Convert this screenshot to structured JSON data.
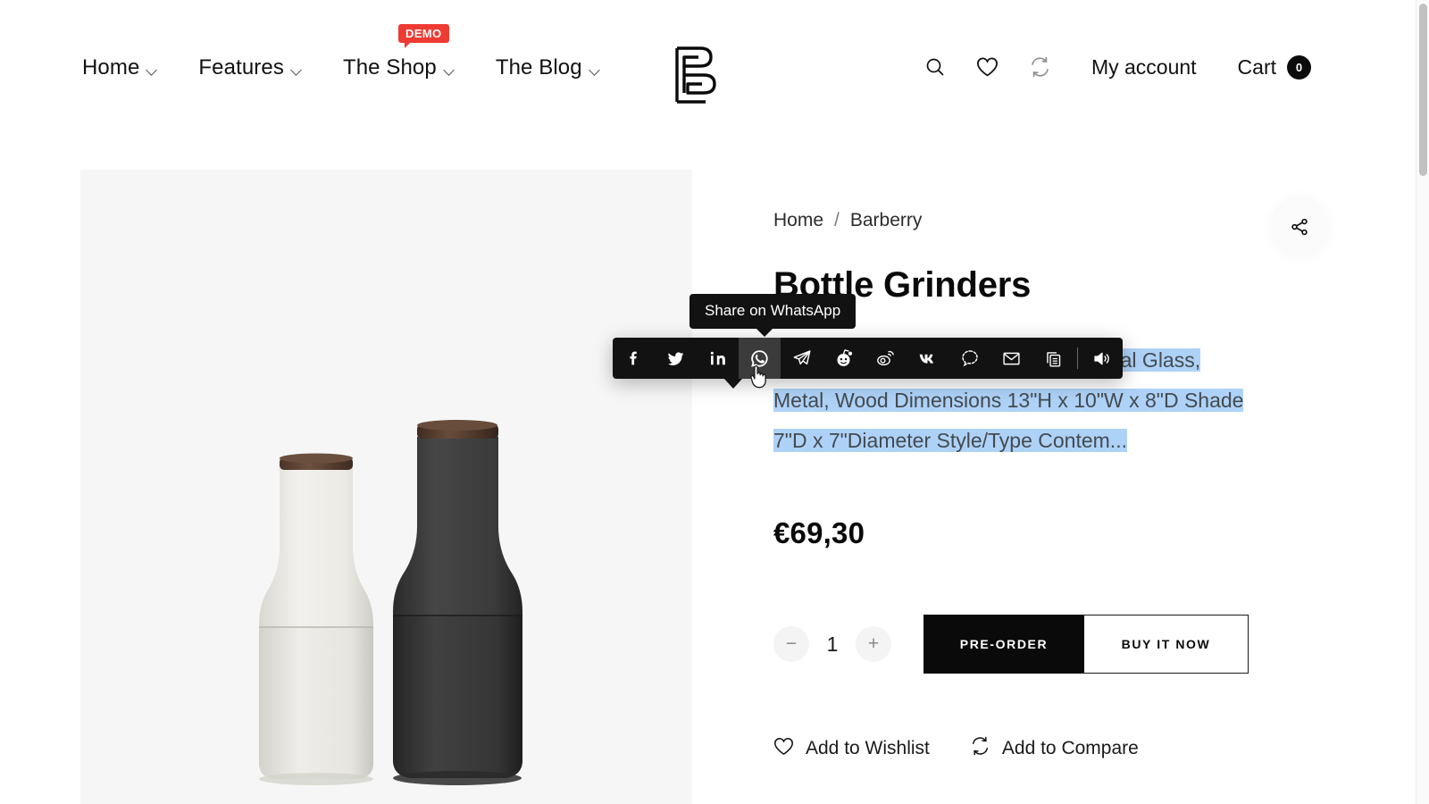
{
  "header": {
    "nav": [
      {
        "label": "Home",
        "caret": true,
        "badge": null
      },
      {
        "label": "Features",
        "caret": true,
        "badge": null
      },
      {
        "label": "The Shop",
        "caret": true,
        "badge": "DEMO"
      },
      {
        "label": "The Blog",
        "caret": true,
        "badge": null
      }
    ],
    "logo_name": "barberry-b-logo",
    "icons": [
      {
        "name": "search-icon"
      },
      {
        "name": "wishlist-heart-icon"
      },
      {
        "name": "compare-refresh-icon"
      }
    ],
    "account_label": "My account",
    "cart_label": "Cart",
    "cart_count": "0"
  },
  "gallery": {
    "background": "#f6f6f6",
    "product_alt": "Two bottle grinders, cream and charcoal, with walnut caps",
    "colors": {
      "light_body": "#e9e8e2",
      "light_top": "#f1f0ec",
      "dark_body": "#3a3a3a",
      "dark_top": "#4a4a4a",
      "wood_cap": "#5d4436"
    }
  },
  "product": {
    "breadcrumb": {
      "home": "Home",
      "separator": "/",
      "current": "Barberry"
    },
    "title": "Bottle Grinders",
    "description": "Color Aqua, Red, White, Yellow Material Glass, Metal, Wood Dimensions 13\"H x 10\"W x 8\"D Shade 7\"D x 7\"Diameter Style/Type Contem...",
    "description_lines": [
      "Color Aqua, Red, White, Yellow Material Glass,",
      "Metal, Wood Dimensions 13\"H x 10\"W x 8\"D Shade",
      "7\"D x 7\"Diameter Style/Type Contem..."
    ],
    "selection_color": "#aed2f7",
    "price": "€69,30",
    "quantity": "1",
    "qty_minus": "−",
    "qty_plus": "+",
    "preorder_label": "PRE-ORDER",
    "buynow_label": "BUY IT NOW",
    "wishlist_label": "Add to Wishlist",
    "compare_label": "Add to Compare"
  },
  "share": {
    "fab_name": "share-nodes-icon",
    "tooltip": "Share on WhatsApp",
    "bar_bg": "#121212",
    "active_bg": "#3b3b3b",
    "items": [
      {
        "name": "facebook-icon",
        "active": false
      },
      {
        "name": "twitter-icon",
        "active": false
      },
      {
        "name": "linkedin-icon",
        "active": false
      },
      {
        "name": "whatsapp-icon",
        "active": true
      },
      {
        "name": "telegram-icon",
        "active": false
      },
      {
        "name": "reddit-icon",
        "active": false
      },
      {
        "name": "weibo-icon",
        "active": false
      },
      {
        "name": "vk-icon",
        "active": false
      },
      {
        "name": "signal-icon",
        "active": false
      },
      {
        "name": "email-icon",
        "active": false
      },
      {
        "name": "copy-link-icon",
        "active": false
      },
      {
        "name": "speaker-icon",
        "active": false
      }
    ]
  },
  "theme": {
    "accent_red": "#ee3b33",
    "text_dark": "#0a0a0a",
    "panel_gray": "#f6f6f6"
  }
}
